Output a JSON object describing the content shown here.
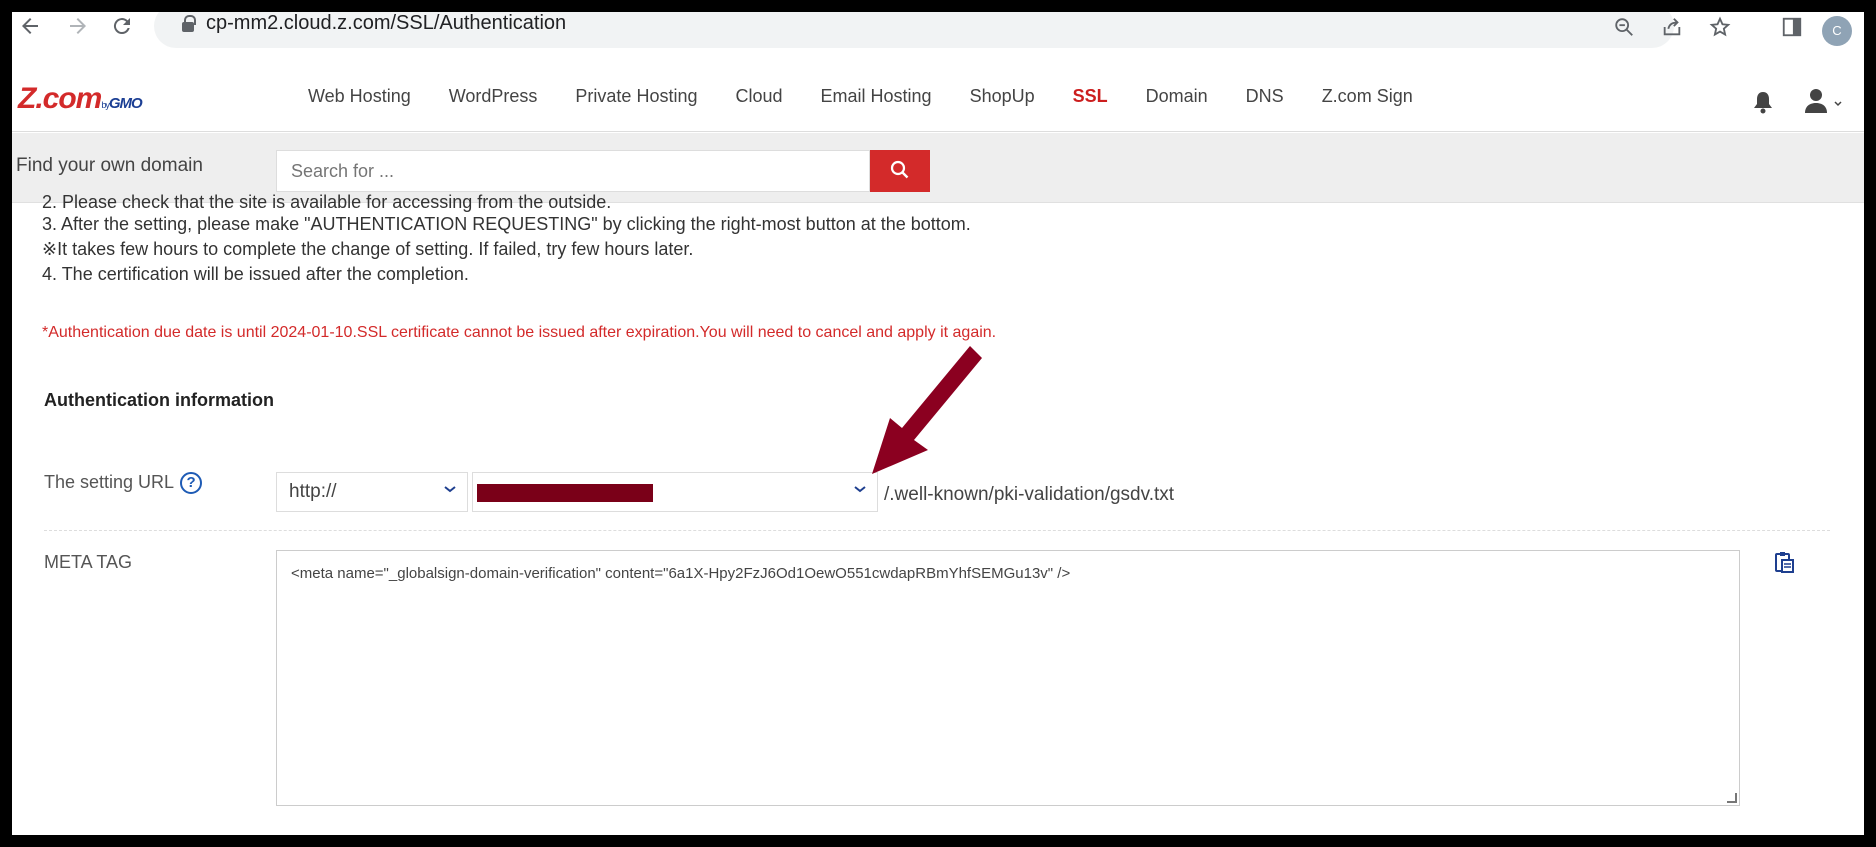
{
  "browser": {
    "url": "cp-mm2.cloud.z.com/SSL/Authentication",
    "profile_initial": "C",
    "icons": [
      "back-icon",
      "forward-icon",
      "reload-icon",
      "zoom-icon",
      "share-icon",
      "star-icon",
      "sidepanel-icon"
    ]
  },
  "header": {
    "logo_main": "Z.com",
    "logo_by": "by",
    "logo_gmo": "GMO",
    "nav": [
      {
        "label": "Web Hosting",
        "active": false
      },
      {
        "label": "WordPress",
        "active": false
      },
      {
        "label": "Private Hosting",
        "active": false
      },
      {
        "label": "Cloud",
        "active": false
      },
      {
        "label": "Email Hosting",
        "active": false
      },
      {
        "label": "ShopUp",
        "active": false
      },
      {
        "label": "SSL",
        "active": true
      },
      {
        "label": "Domain",
        "active": false
      },
      {
        "label": "DNS",
        "active": false
      },
      {
        "label": "Z.com Sign",
        "active": false
      }
    ]
  },
  "search": {
    "label": "Find your own domain",
    "placeholder": "Search for ..."
  },
  "steps": {
    "step2": "2.  Please check that the site is available for accessing from the outside.",
    "step3": "3.  After the setting, please make \"AUTHENTICATION REQUESTING\" by clicking the right-most button at the bottom.",
    "note": "※It takes few hours to complete the change of setting. If failed, try few hours later.",
    "step4": "4.   The certification will be issued after the completion."
  },
  "warning": "*Authentication due date is until 2024-01-10.SSL certificate cannot be issued after expiration.You will need to cancel and apply it again.",
  "auth": {
    "section_title": "Authentication information",
    "setting_url_label": "The setting URL",
    "help": "?",
    "protocol": "http://",
    "path": "/.well-known/pki-validation/gsdv.txt",
    "meta_label": "META TAG",
    "meta_value": "<meta name=\"_globalsign-domain-verification\" content=\"6a1X-Hpy2FzJ6Od1OewO551cwdapRBmYhfSEMGu13v\" />"
  },
  "colors": {
    "brand_red": "#d32a2a",
    "annotation_arrow": "#8b0020",
    "link_blue": "#1e5bb5"
  }
}
